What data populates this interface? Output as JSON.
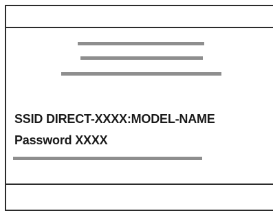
{
  "network_info": {
    "ssid_line": "SSID DIRECT-XXXX:MODEL-NAME",
    "password_line": "Password XXXX"
  },
  "colors": {
    "frame": "#2b2b2b",
    "placeholder": "#8e8e8e",
    "text": "#1a1a1a",
    "background": "#ffffff"
  }
}
